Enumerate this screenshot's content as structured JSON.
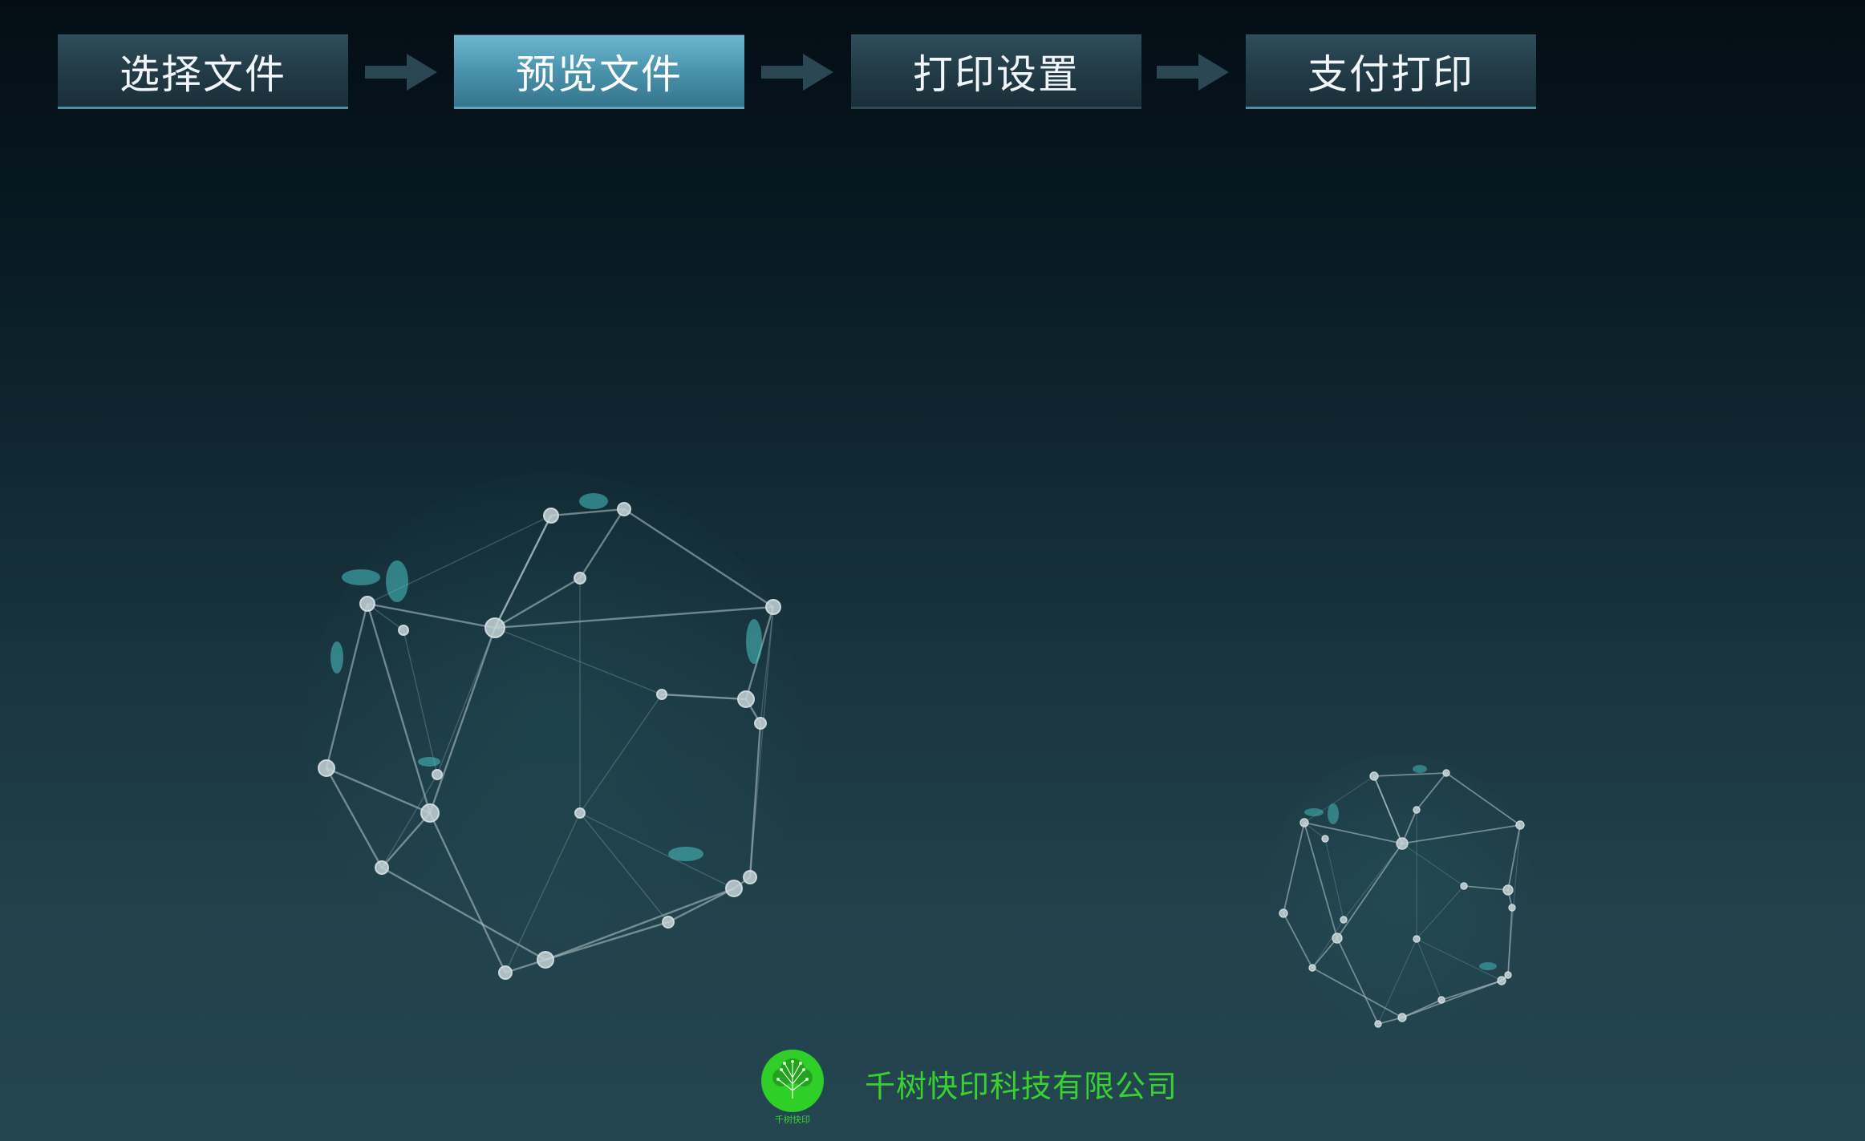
{
  "steps": [
    {
      "label": "选择文件",
      "state": "done"
    },
    {
      "label": "预览文件",
      "state": "active"
    },
    {
      "label": "打印设置",
      "state": "pending"
    },
    {
      "label": "支付打印",
      "state": "pending"
    }
  ],
  "footer": {
    "company_name": "千树快印科技有限公司",
    "logo_caption": "千树快印"
  },
  "colors": {
    "accent": "#4a93ad",
    "brand_green": "#39d12f"
  },
  "icons": {
    "step_arrow": "arrow-right-icon",
    "logo": "tree-logo-icon",
    "decoration": "network-globe-icon"
  }
}
